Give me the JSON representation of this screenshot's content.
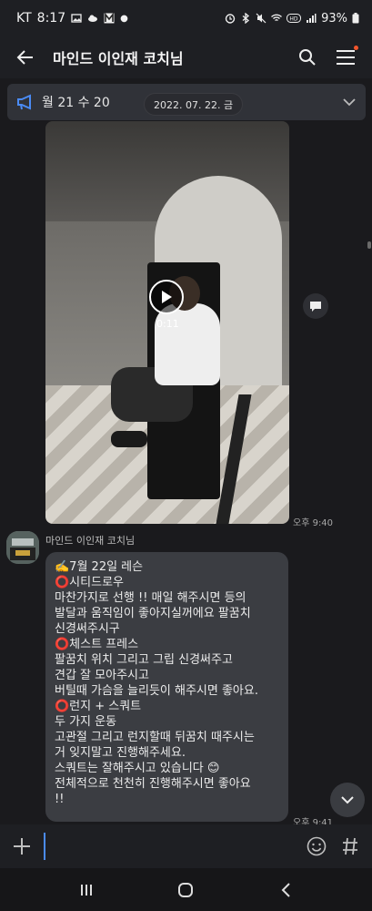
{
  "status_bar": {
    "carrier": "KT",
    "time": "8:17",
    "battery": "93%"
  },
  "header": {
    "title": "마인드 이인재 코치님"
  },
  "notice": {
    "text": "월 21  수 20"
  },
  "date_divider": "2022. 07. 22. 금",
  "video": {
    "duration": "0:11",
    "time": "오후 9:40"
  },
  "sender": {
    "name": "마인드 이인재 코치님"
  },
  "message": {
    "lines": [
      "✍️7월 22일 레슨",
      "⭕시티드로우",
      "마찬가지로 선행 !! 매일 해주시면 등의",
      "발달과 움직임이 좋아지실꺼에요 팔꿈치",
      "신경써주시구",
      "⭕체스트 프레스",
      "팔꿈치 위치 그리고 그립 신경써주고",
      "견갑 잘 모아주시고",
      "버틸때 가슴을 늘리듯이 해주시면 좋아요.",
      "⭕런지 + 스쿼트",
      "두 가지 운동",
      "고관절 그리고 런지할때 뒤꿈치 때주시는",
      "거 잊지말고 진행해주세요.",
      "스쿼트는 잘해주시고 있습니다 😊",
      "전체적으로 천천히 진행해주시면 좋아요",
      "!!"
    ],
    "time": "오후 9:41"
  },
  "input": {
    "value": "",
    "placeholder": ""
  },
  "colors": {
    "background": "#1a1a1d",
    "bubble": "#3b3d42",
    "accent_red": "#e1323a",
    "cursor_blue": "#4a8bf5"
  }
}
